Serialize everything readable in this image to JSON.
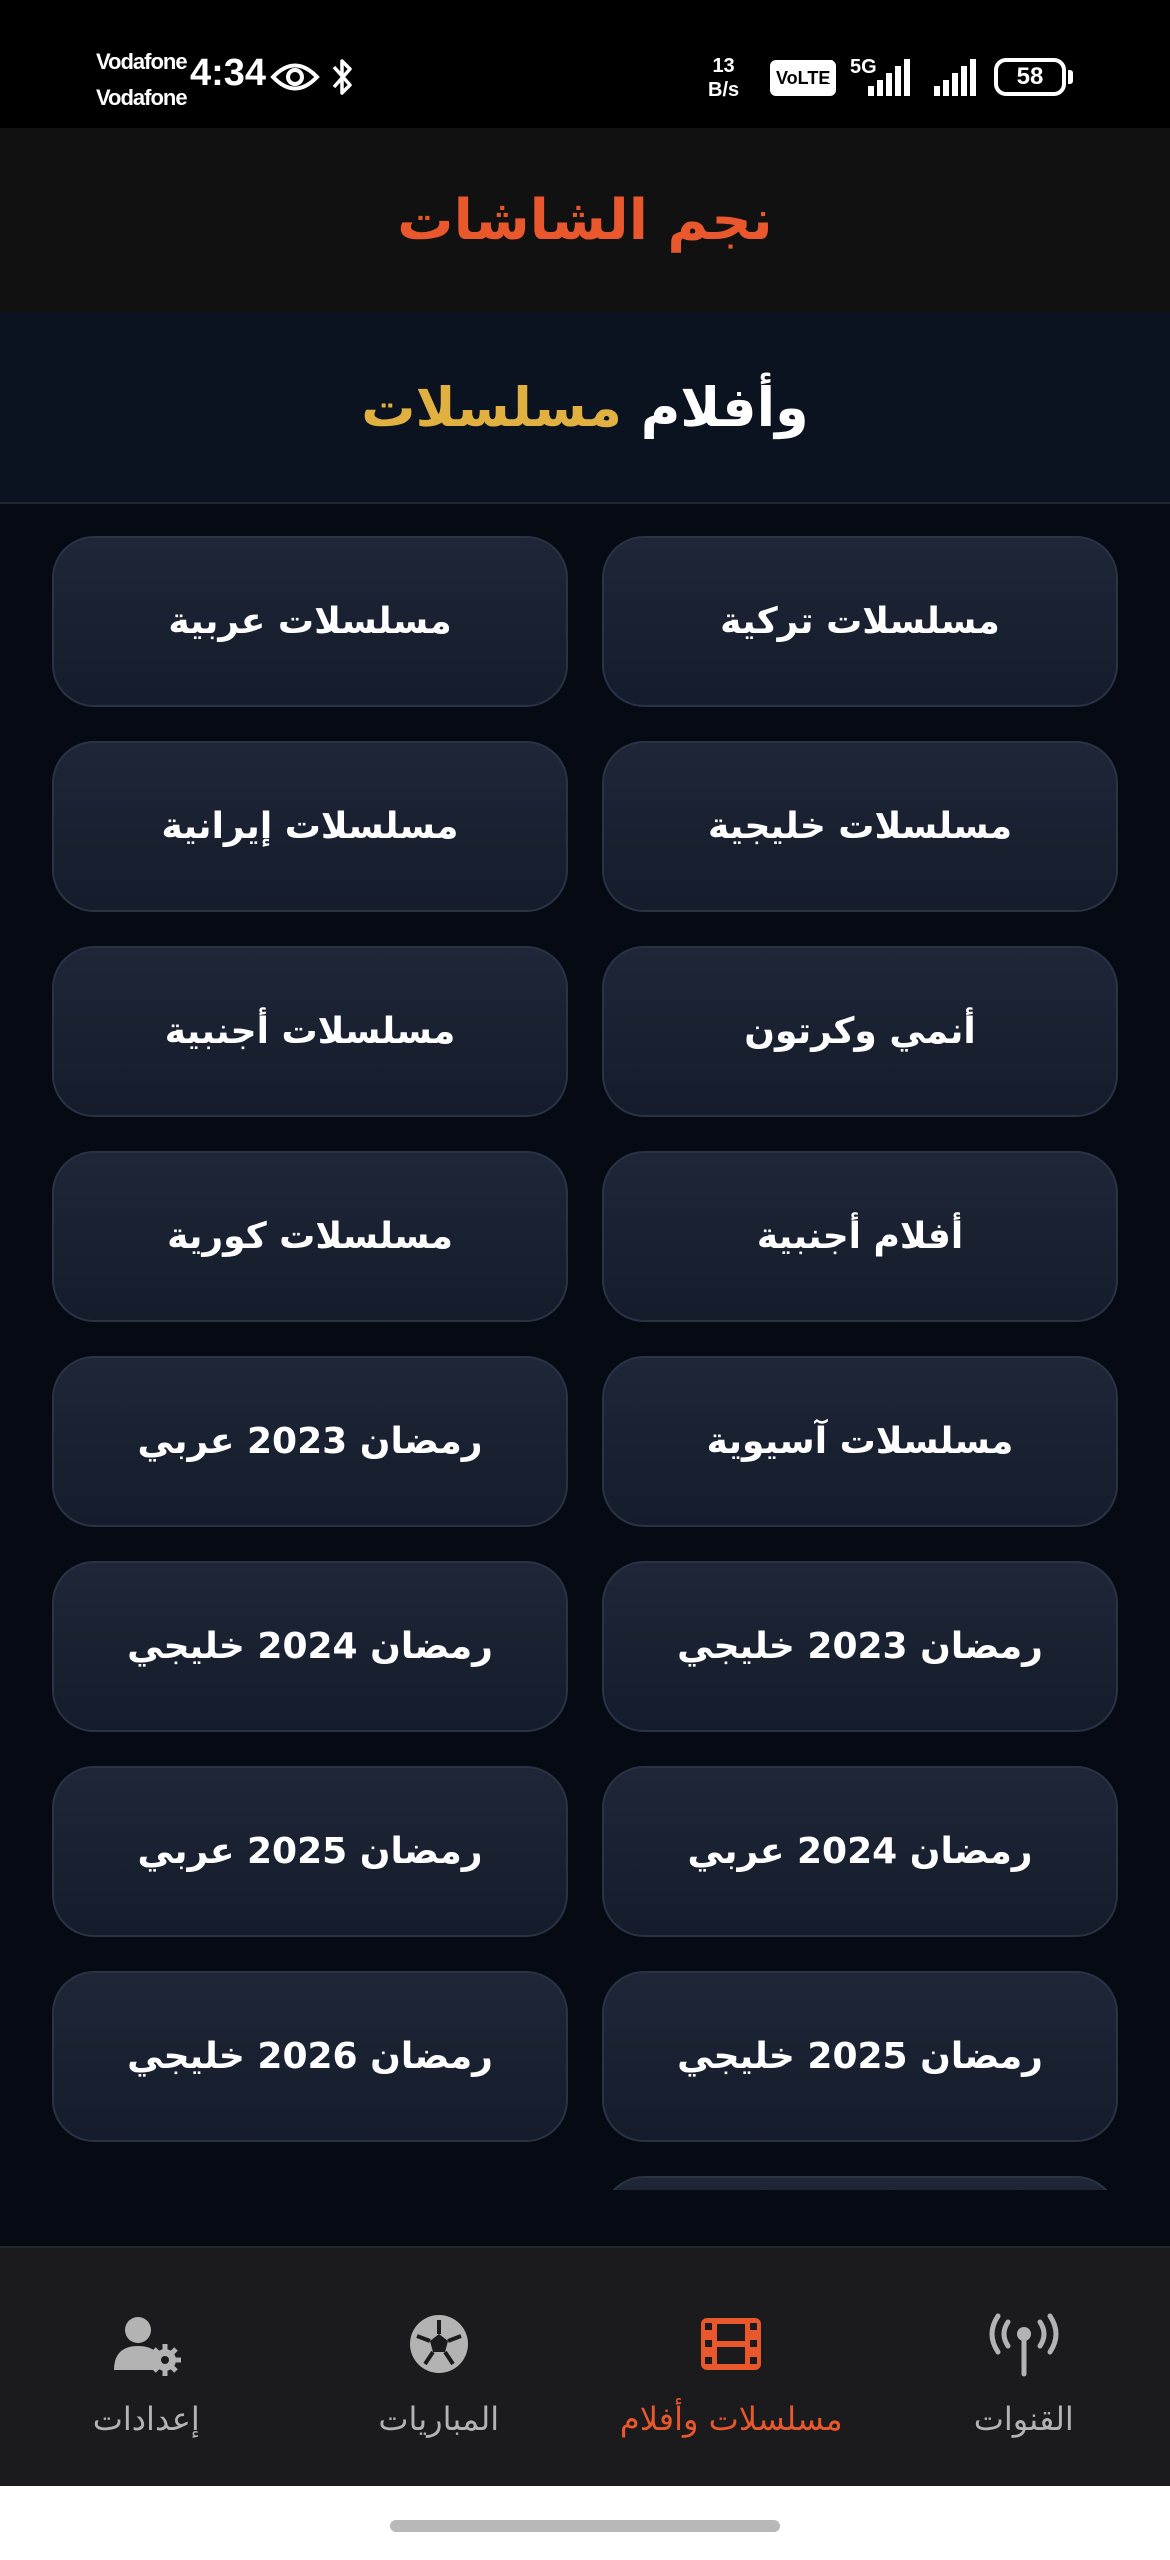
{
  "status_bar": {
    "carrier_1": "Vodafone",
    "carrier_2": "Vodafone",
    "time": "4:34",
    "net_speed_value": "13",
    "net_speed_unit": "B/s",
    "volte": "VoLTE",
    "sim_index_1": "1",
    "sim_index_2": "2",
    "network_type": "5G",
    "battery_level": "58"
  },
  "app_bar": {
    "title": "نجم الشاشات"
  },
  "section": {
    "title_part1": "وأفلام",
    "title_part2": "مسلسلات"
  },
  "categories": [
    "مسلسلات تركية",
    "مسلسلات عربية",
    "مسلسلات خليجية",
    "مسلسلات إيرانية",
    "أنمي وكرتون",
    "مسلسلات أجنبية",
    "أفلام أجنبية",
    "مسلسلات كورية",
    "مسلسلات آسيوية",
    "رمضان 2023 عربي",
    "رمضان 2023 خليجي",
    "رمضان 2024 خليجي",
    "رمضان 2024 عربي",
    "رمضان 2025 عربي",
    "رمضان 2025 خليجي",
    "رمضان 2026 خليجي",
    ""
  ],
  "bottom_nav": {
    "items": [
      {
        "label": "القنوات",
        "icon": "broadcast-tower-icon",
        "active": false
      },
      {
        "label": "مسلسلات وأفلام",
        "icon": "film-icon",
        "active": true
      },
      {
        "label": "المباريات",
        "icon": "football-icon",
        "active": false
      },
      {
        "label": "إعدادات",
        "icon": "user-settings-icon",
        "active": false
      }
    ]
  },
  "colors": {
    "accent": "#e8582c",
    "gold": "#e0b040",
    "inactive": "#b3b3b3"
  }
}
